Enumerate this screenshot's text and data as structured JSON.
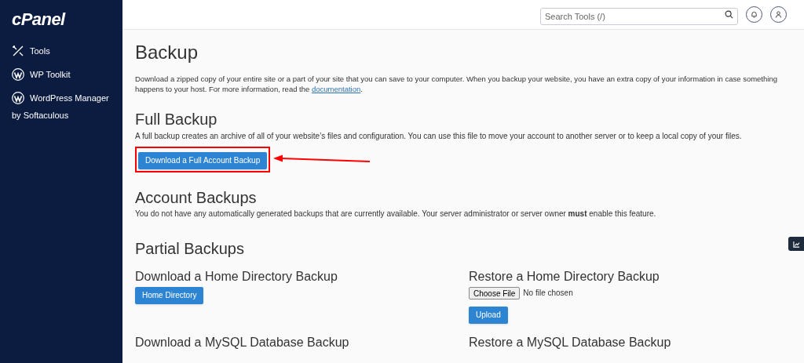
{
  "sidebar": {
    "logo": "cPanel",
    "items": [
      {
        "label": "Tools",
        "kind": "tools"
      },
      {
        "label": "WP Toolkit",
        "kind": "wordpress"
      },
      {
        "label": "WordPress Manager",
        "kind": "wordpress",
        "subtitle": "by Softaculous"
      }
    ]
  },
  "header": {
    "search": {
      "placeholder": "Search Tools (/)"
    }
  },
  "page": {
    "title": "Backup",
    "intro": "Download a zipped copy of your entire site or a part of your site that you can save to your computer. When you backup your website, you have an extra copy of your information in case something happens to your host. For more information, read the",
    "intro_link": "documentation",
    "intro_end": ".",
    "full_backup": {
      "title": "Full Backup",
      "text": "A full backup creates an archive of all of your website’s files and configuration. You can use this file to move your account to another server or to keep a local copy of your files.",
      "button": "Download a Full Account Backup",
      "highlighted": true
    },
    "account_backups": {
      "title": "Account Backups",
      "text": "You do not have any automatically generated backups that are currently available. Your server administrator or server owner **must** enable this feature."
    },
    "partial_backups": {
      "title": "Partial Backups",
      "download_home": {
        "title": "Download a Home Directory Backup",
        "button": "Home Directory"
      },
      "restore_home": {
        "title": "Restore a Home Directory Backup",
        "file_button": "Choose File",
        "file_status": "No file chosen",
        "button": "Upload"
      },
      "download_mysql": {
        "title": "Download a MySQL Database Backup"
      },
      "restore_mysql": {
        "title": "Restore a MySQL Database Backup"
      }
    }
  }
}
